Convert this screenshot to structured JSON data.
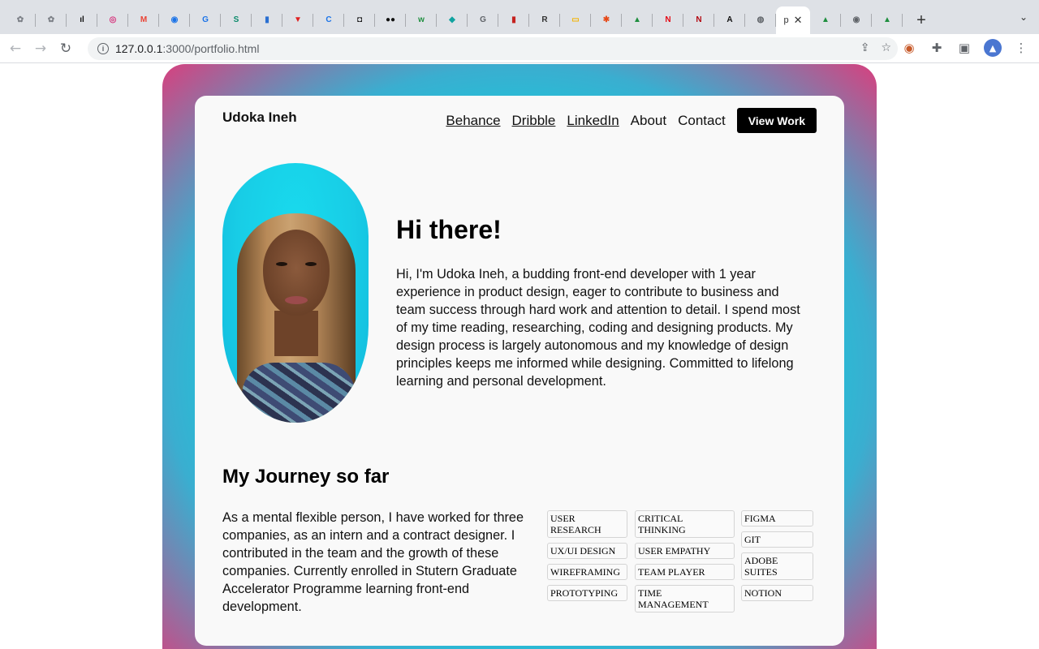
{
  "browser": {
    "tabs": [
      {
        "icon": "app-icon",
        "glyph": "✿",
        "color": "#7b7f86"
      },
      {
        "icon": "app-icon",
        "glyph": "✿",
        "color": "#7b7f86"
      },
      {
        "icon": "pluralsight-icon",
        "glyph": "ıl",
        "color": "#111111"
      },
      {
        "icon": "instagram-icon",
        "glyph": "◎",
        "color": "#d6317b"
      },
      {
        "icon": "gmail-icon",
        "glyph": "M",
        "color": "#ea4335"
      },
      {
        "icon": "chrome-app-icon",
        "glyph": "◉",
        "color": "#1a73e8"
      },
      {
        "icon": "grammarly-icon",
        "glyph": "G",
        "color": "#1a73e8"
      },
      {
        "icon": "scribd-icon",
        "glyph": "S",
        "color": "#0a8a6b"
      },
      {
        "icon": "book-icon",
        "glyph": "▮",
        "color": "#2a6fd1"
      },
      {
        "icon": "vivaldi-icon",
        "glyph": "▼",
        "color": "#e02020"
      },
      {
        "icon": "coursera-icon",
        "glyph": "C",
        "color": "#1a73e8"
      },
      {
        "icon": "media-icon",
        "glyph": "◘",
        "color": "#111111"
      },
      {
        "icon": "medium-icon",
        "glyph": "●●",
        "color": "#111111"
      },
      {
        "icon": "webflow-icon",
        "glyph": "w",
        "color": "#1e8e3e"
      },
      {
        "icon": "diamond-icon",
        "glyph": "◆",
        "color": "#11a3a0"
      },
      {
        "icon": "docs-icon",
        "glyph": "G",
        "color": "#5f6368"
      },
      {
        "icon": "bookmark-icon",
        "glyph": "▮",
        "color": "#c5221f"
      },
      {
        "icon": "r-icon",
        "glyph": "R",
        "color": "#333333"
      },
      {
        "icon": "slides-icon",
        "glyph": "▭",
        "color": "#f4b400"
      },
      {
        "icon": "asterisk-icon",
        "glyph": "✱",
        "color": "#e64a19"
      },
      {
        "icon": "drive-icon",
        "glyph": "▲",
        "color": "#1e8e3e"
      },
      {
        "icon": "netflix-icon",
        "glyph": "N",
        "color": "#e50914"
      },
      {
        "icon": "netflix-icon",
        "glyph": "N",
        "color": "#b20710"
      },
      {
        "icon": "archive-icon",
        "glyph": "A",
        "color": "#111111"
      },
      {
        "icon": "globe-icon",
        "glyph": "◍",
        "color": "#5f6368"
      }
    ],
    "active_tab": {
      "title_initial": "p",
      "close": "✕"
    },
    "trailing_tabs": [
      {
        "icon": "drive-icon",
        "glyph": "▲",
        "color": "#1e8e3e"
      },
      {
        "icon": "chrome-icon",
        "glyph": "◉",
        "color": "#5f6368"
      },
      {
        "icon": "drive-icon",
        "glyph": "▲",
        "color": "#1e8e3e"
      }
    ],
    "new_tab": "+",
    "tab_menu": "⌄",
    "back": "←",
    "forward": "→",
    "reload": "↻",
    "url_host": "127.0.0.1",
    "url_rest": ":3000/portfolio.html",
    "share_icon": "⇪",
    "star_icon": "☆",
    "ext_icon": "✚",
    "sidepanel_icon": "▣",
    "profile_initial": "▲",
    "menu_icon": "⋮"
  },
  "page": {
    "brand": "Udoka Ineh",
    "nav": {
      "behance": "Behance",
      "dribble": "Dribble",
      "linkedin": "LinkedIn",
      "about": "About",
      "contact": "Contact",
      "view_work": "View Work"
    },
    "hero": {
      "greeting": "Hi there!",
      "bio": "Hi, I'm Udoka Ineh, a budding front-end developer with 1 year experience in product design, eager to contribute to business and team success through hard work and attention to detail. I spend most of my time reading, researching, coding and designing products. My design process is largely autonomous and my knowledge of design principles keeps me informed while designing. Committed to lifelong learning and personal development."
    },
    "journey": {
      "title": "My Journey so far",
      "text": "As a mental flexible person, I have worked for three companies, as an intern and a contract designer. I contributed in the team and the growth of these companies. Currently enrolled in Stutern Graduate Accelerator Programme learning front-end development."
    },
    "skills": {
      "col1": [
        "USER RESEARCH",
        "UX/UI DESIGN",
        "WIREFRAMING",
        "PROTOTYPING"
      ],
      "col2": [
        "CRITICAL THINKING",
        "USER EMPATHY",
        "TEAM PLAYER",
        "TIME MANAGEMENT"
      ],
      "col3": [
        "FIGMA",
        "GIT",
        "ADOBE SUITES",
        "NOTION"
      ]
    }
  }
}
